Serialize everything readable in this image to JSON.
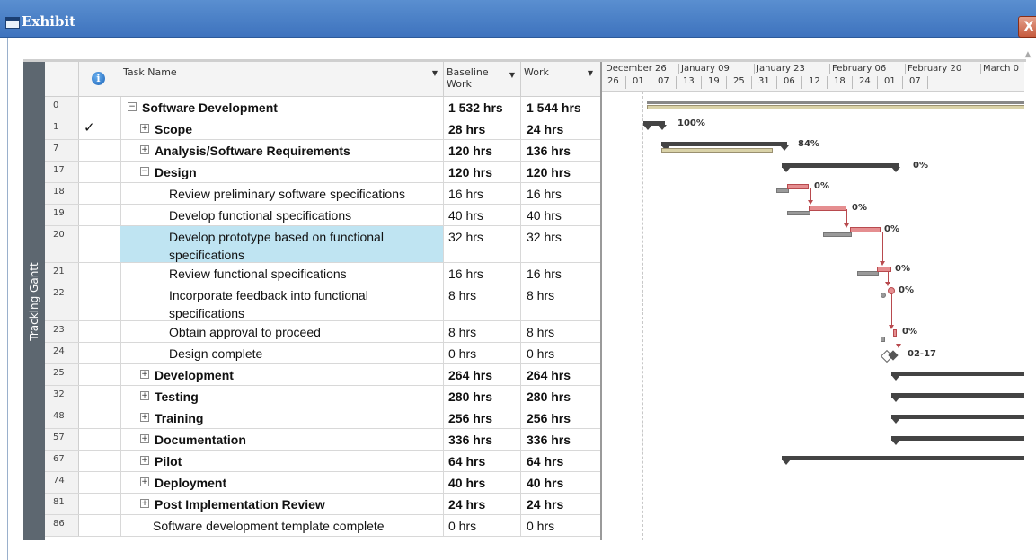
{
  "window": {
    "title": "Exhibit",
    "close_label": "X"
  },
  "sideband": {
    "label": "Tracking Gantt"
  },
  "columns": {
    "task_name": "Task Name",
    "baseline_work": "Baseline Work",
    "work": "Work"
  },
  "timescale": {
    "top": [
      "December 26",
      "January 09",
      "January 23",
      "February 06",
      "February 20",
      "March 0"
    ],
    "bottom": [
      "26",
      "01",
      "07",
      "13",
      "19",
      "25",
      "31",
      "06",
      "12",
      "18",
      "24",
      "01",
      "07"
    ]
  },
  "rows": [
    {
      "id": "0",
      "name": "Software Development",
      "baseline": "1 532 hrs",
      "work": "1 544 hrs",
      "bold": true,
      "toggle": "−",
      "checked": false
    },
    {
      "id": "1",
      "name": "Scope",
      "baseline": "28 hrs",
      "work": "24 hrs",
      "bold": true,
      "toggle": "+",
      "checked": true
    },
    {
      "id": "7",
      "name": "Analysis/Software Requirements",
      "baseline": "120 hrs",
      "work": "136 hrs",
      "bold": true,
      "toggle": "+",
      "checked": false
    },
    {
      "id": "17",
      "name": "Design",
      "baseline": "120 hrs",
      "work": "120 hrs",
      "bold": true,
      "toggle": "−",
      "checked": false
    },
    {
      "id": "18",
      "name": "Review preliminary software specifications",
      "baseline": "16 hrs",
      "work": "16 hrs",
      "bold": false,
      "checked": false
    },
    {
      "id": "19",
      "name": "Develop functional specifications",
      "baseline": "40 hrs",
      "work": "40 hrs",
      "bold": false,
      "checked": false
    },
    {
      "id": "20",
      "name": "Develop prototype based on functional specifications",
      "baseline": "32 hrs",
      "work": "32 hrs",
      "bold": false,
      "checked": false,
      "selected": true
    },
    {
      "id": "21",
      "name": "Review functional specifications",
      "baseline": "16 hrs",
      "work": "16 hrs",
      "bold": false,
      "checked": false
    },
    {
      "id": "22",
      "name": "Incorporate feedback into functional specifications",
      "baseline": "8 hrs",
      "work": "8 hrs",
      "bold": false,
      "checked": false
    },
    {
      "id": "23",
      "name": "Obtain approval to proceed",
      "baseline": "8 hrs",
      "work": "8 hrs",
      "bold": false,
      "checked": false
    },
    {
      "id": "24",
      "name": "Design complete",
      "baseline": "0 hrs",
      "work": "0 hrs",
      "bold": false,
      "checked": false
    },
    {
      "id": "25",
      "name": "Development",
      "baseline": "264 hrs",
      "work": "264 hrs",
      "bold": true,
      "toggle": "+",
      "checked": false
    },
    {
      "id": "32",
      "name": "Testing",
      "baseline": "280 hrs",
      "work": "280 hrs",
      "bold": true,
      "toggle": "+",
      "checked": false
    },
    {
      "id": "48",
      "name": "Training",
      "baseline": "256 hrs",
      "work": "256 hrs",
      "bold": true,
      "toggle": "+",
      "checked": false
    },
    {
      "id": "57",
      "name": "Documentation",
      "baseline": "336 hrs",
      "work": "336 hrs",
      "bold": true,
      "toggle": "+",
      "checked": false
    },
    {
      "id": "67",
      "name": "Pilot",
      "baseline": "64 hrs",
      "work": "64 hrs",
      "bold": true,
      "toggle": "+",
      "checked": false
    },
    {
      "id": "74",
      "name": "Deployment",
      "baseline": "40 hrs",
      "work": "40 hrs",
      "bold": true,
      "toggle": "+",
      "checked": false
    },
    {
      "id": "81",
      "name": "Post Implementation Review",
      "baseline": "24 hrs",
      "work": "24 hrs",
      "bold": true,
      "toggle": "+",
      "checked": false
    },
    {
      "id": "86",
      "name": "Software development template complete",
      "baseline": "0 hrs",
      "work": "0 hrs",
      "bold": false,
      "checked": false
    }
  ],
  "gantt_labels": {
    "scope": "100%",
    "analysis": "84%",
    "design": "0%",
    "t18": "0%",
    "t19": "0%",
    "t20": "0%",
    "t21": "0%",
    "t22": "0%",
    "t23": "0%",
    "milestone": "02-17"
  }
}
